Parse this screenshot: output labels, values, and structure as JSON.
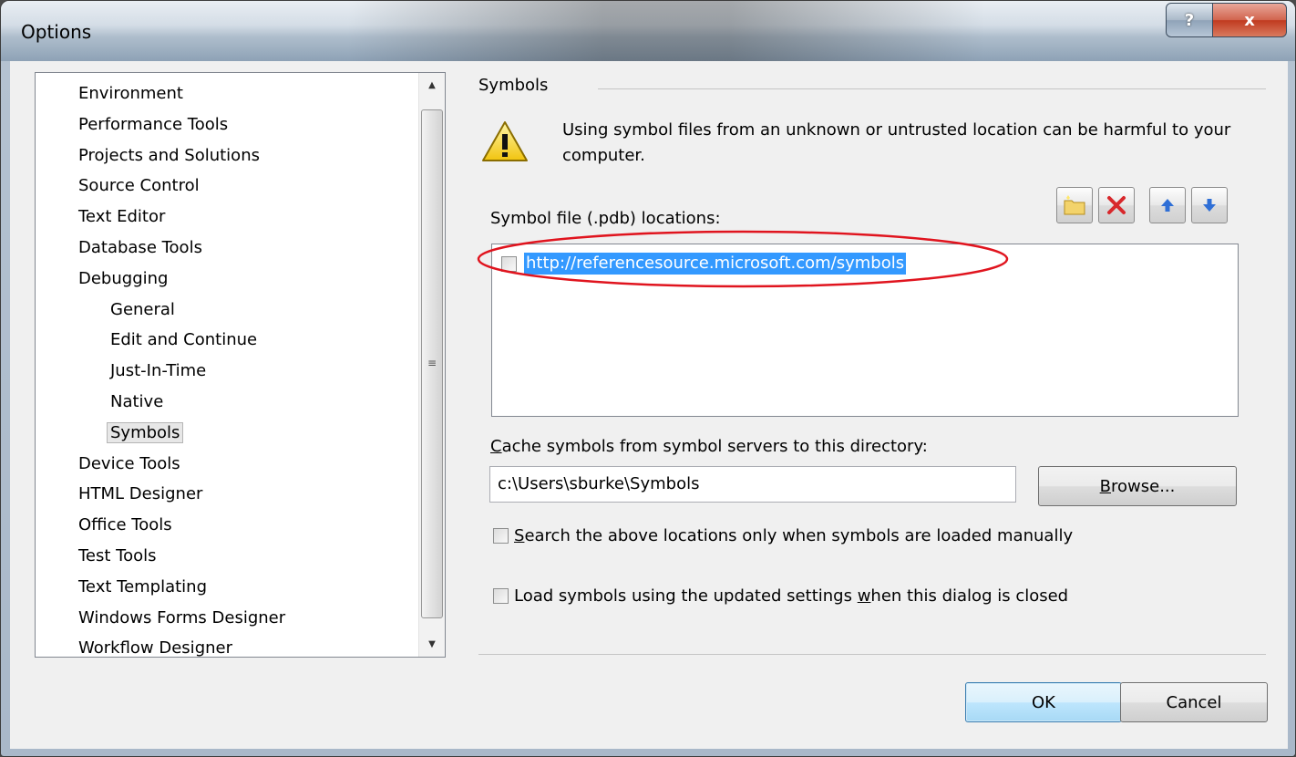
{
  "window": {
    "title": "Options",
    "help_label": "?",
    "close_label": "x"
  },
  "tree": {
    "items": [
      {
        "label": "Environment",
        "indent": 0
      },
      {
        "label": "Performance Tools",
        "indent": 0
      },
      {
        "label": "Projects and Solutions",
        "indent": 0
      },
      {
        "label": "Source Control",
        "indent": 0
      },
      {
        "label": "Text Editor",
        "indent": 0
      },
      {
        "label": "Database Tools",
        "indent": 0
      },
      {
        "label": "Debugging",
        "indent": 0
      },
      {
        "label": "General",
        "indent": 1
      },
      {
        "label": "Edit and Continue",
        "indent": 1
      },
      {
        "label": "Just-In-Time",
        "indent": 1
      },
      {
        "label": "Native",
        "indent": 1
      },
      {
        "label": "Symbols",
        "indent": 1,
        "selected": true
      },
      {
        "label": "Device Tools",
        "indent": 0
      },
      {
        "label": "HTML Designer",
        "indent": 0
      },
      {
        "label": "Office Tools",
        "indent": 0
      },
      {
        "label": "Test Tools",
        "indent": 0
      },
      {
        "label": "Text Templating",
        "indent": 0
      },
      {
        "label": "Windows Forms Designer",
        "indent": 0
      },
      {
        "label": "Workflow Designer",
        "indent": 0
      }
    ]
  },
  "symbols": {
    "group_label": "Symbols",
    "warning_text": "Using symbol files from an unknown or untrusted location can be harmful to your computer.",
    "locations_label": "Symbol file (.pdb) locations:",
    "toolbar": [
      {
        "name": "new-folder-icon"
      },
      {
        "name": "delete-icon"
      },
      {
        "name": "move-up-icon"
      },
      {
        "name": "move-down-icon"
      }
    ],
    "locations": [
      {
        "url": "http://referencesource.microsoft.com/symbols",
        "checked": false
      }
    ],
    "cache_label_accel": "C",
    "cache_label_rest": "ache symbols from symbol servers to this directory:",
    "cache_value": "c:\\Users\\sburke\\Symbols",
    "browse_accel": "B",
    "browse_rest": "rowse...",
    "option1_accel": "S",
    "option1_rest": "earch the above locations only when symbols are loaded manually",
    "option2_pre": "Load symbols using the updated settings ",
    "option2_accel": "w",
    "option2_post": "hen this dialog is closed"
  },
  "footer": {
    "ok_label": "OK",
    "cancel_label": "Cancel"
  },
  "colors": {
    "selection": "#3399ff",
    "annotation": "#e0141e"
  }
}
